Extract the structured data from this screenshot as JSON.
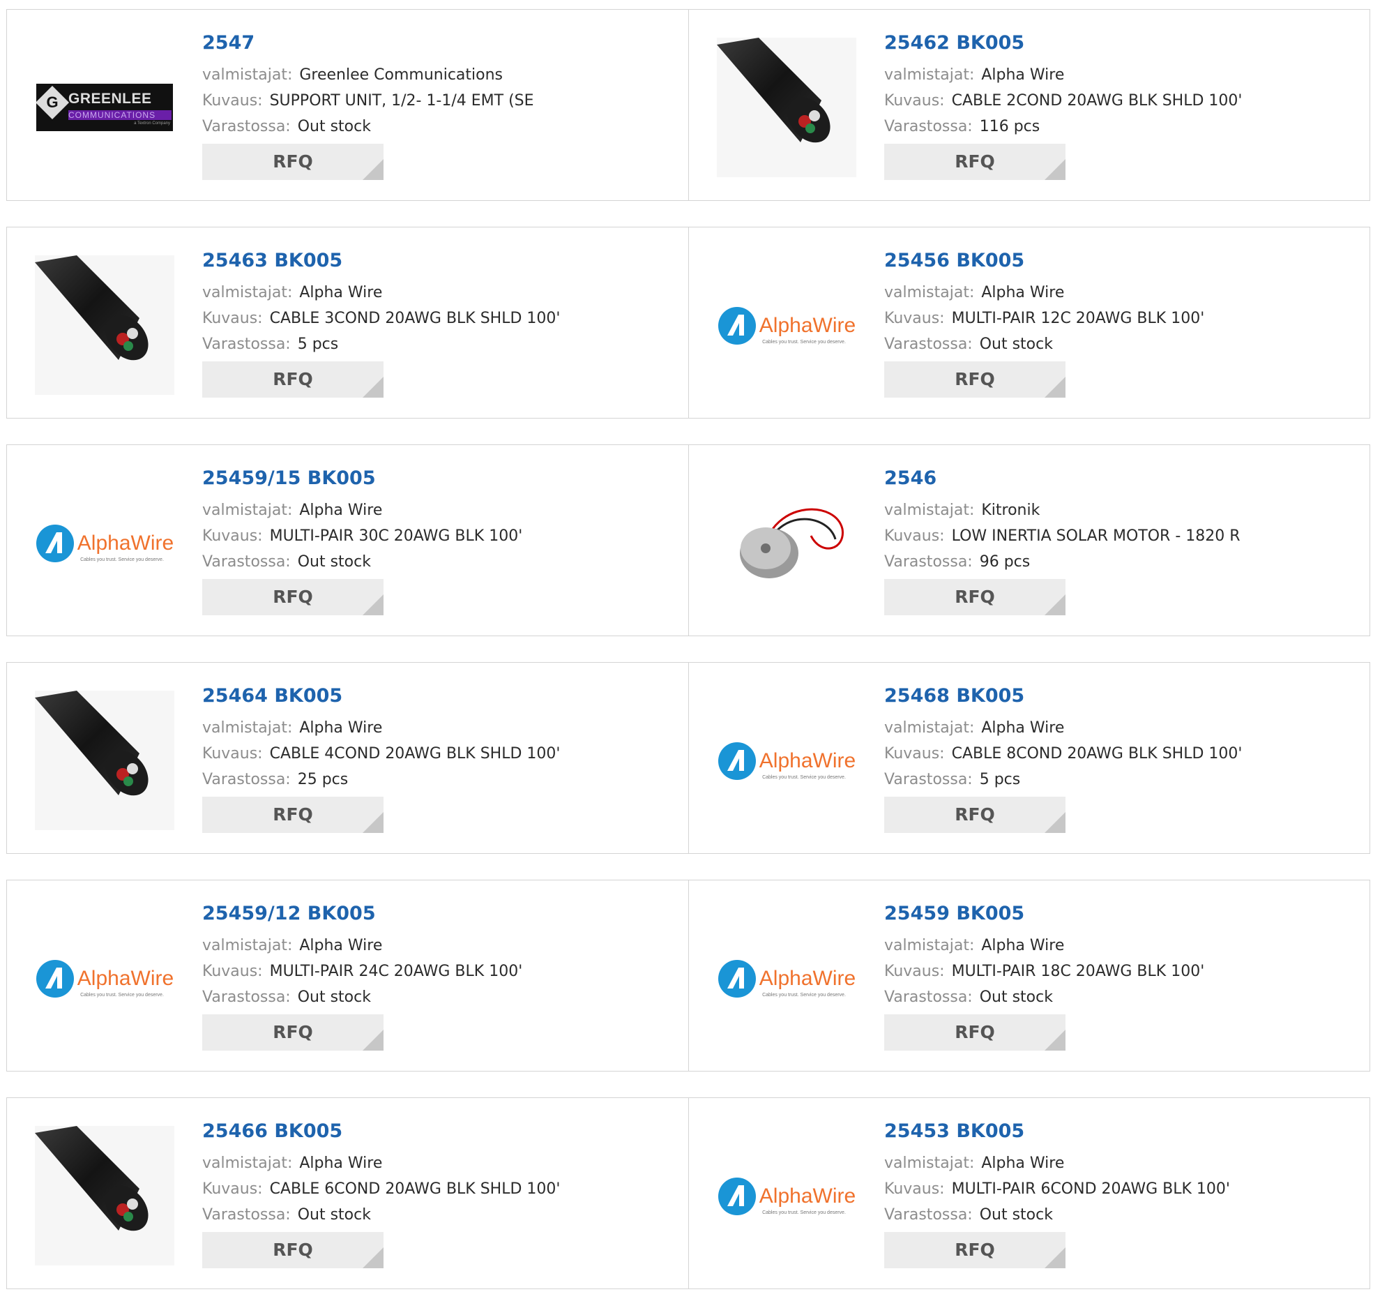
{
  "labels": {
    "manufacturer": "valmistajat:",
    "description": "Kuvaus:",
    "stock": "Varastossa:",
    "rfq": "RFQ"
  },
  "logos": {
    "greenlee": {
      "name": "GREENLEE",
      "sub": "COMMUNICATIONS",
      "tag": "a Textron Company",
      "mark": "G"
    },
    "alphawire": {
      "name_a": "Alpha",
      "name_b": "Wire",
      "tag": "Cables you trust. Service you deserve."
    }
  },
  "colors": {
    "link": "#1e63ad",
    "label": "#8c8c8c",
    "value": "#2b2b2b",
    "rfq_bg": "#ececec",
    "border": "#d4d4d4",
    "alphawire_blue": "#1a95d6",
    "alphawire_orange": "#f0722d"
  },
  "products": [
    {
      "part": "2547",
      "manufacturer": "Greenlee Communications",
      "description": "SUPPORT UNIT, 1/2- 1-1/4 EMT (SE",
      "stock": "Out stock",
      "image": "greenlee-logo"
    },
    {
      "part": "25462 BK005",
      "manufacturer": "Alpha Wire",
      "description": "CABLE 2COND 20AWG BLK SHLD 100'",
      "stock": "116 pcs",
      "image": "cable-photo"
    },
    {
      "part": "25463 BK005",
      "manufacturer": "Alpha Wire",
      "description": "CABLE 3COND 20AWG BLK SHLD 100'",
      "stock": "5 pcs",
      "image": "cable-photo"
    },
    {
      "part": "25456 BK005",
      "manufacturer": "Alpha Wire",
      "description": "MULTI-PAIR 12C 20AWG BLK 100'",
      "stock": "Out stock",
      "image": "alphawire-logo"
    },
    {
      "part": "25459/15 BK005",
      "manufacturer": "Alpha Wire",
      "description": "MULTI-PAIR 30C 20AWG BLK 100'",
      "stock": "Out stock",
      "image": "alphawire-logo"
    },
    {
      "part": "2546",
      "manufacturer": "Kitronik",
      "description": "LOW INERTIA SOLAR MOTOR - 1820 R",
      "stock": "96 pcs",
      "image": "motor-photo"
    },
    {
      "part": "25464 BK005",
      "manufacturer": "Alpha Wire",
      "description": "CABLE 4COND 20AWG BLK SHLD 100'",
      "stock": "25 pcs",
      "image": "cable-photo"
    },
    {
      "part": "25468 BK005",
      "manufacturer": "Alpha Wire",
      "description": "CABLE 8COND 20AWG BLK SHLD 100'",
      "stock": "5 pcs",
      "image": "alphawire-logo"
    },
    {
      "part": "25459/12 BK005",
      "manufacturer": "Alpha Wire",
      "description": "MULTI-PAIR 24C 20AWG BLK 100'",
      "stock": "Out stock",
      "image": "alphawire-logo"
    },
    {
      "part": "25459 BK005",
      "manufacturer": "Alpha Wire",
      "description": "MULTI-PAIR 18C 20AWG BLK 100'",
      "stock": "Out stock",
      "image": "alphawire-logo"
    },
    {
      "part": "25466 BK005",
      "manufacturer": "Alpha Wire",
      "description": "CABLE 6COND 20AWG BLK SHLD 100'",
      "stock": "Out stock",
      "image": "cable-photo"
    },
    {
      "part": "25453 BK005",
      "manufacturer": "Alpha Wire",
      "description": "MULTI-PAIR 6COND 20AWG BLK 100'",
      "stock": "Out stock",
      "image": "alphawire-logo"
    }
  ]
}
